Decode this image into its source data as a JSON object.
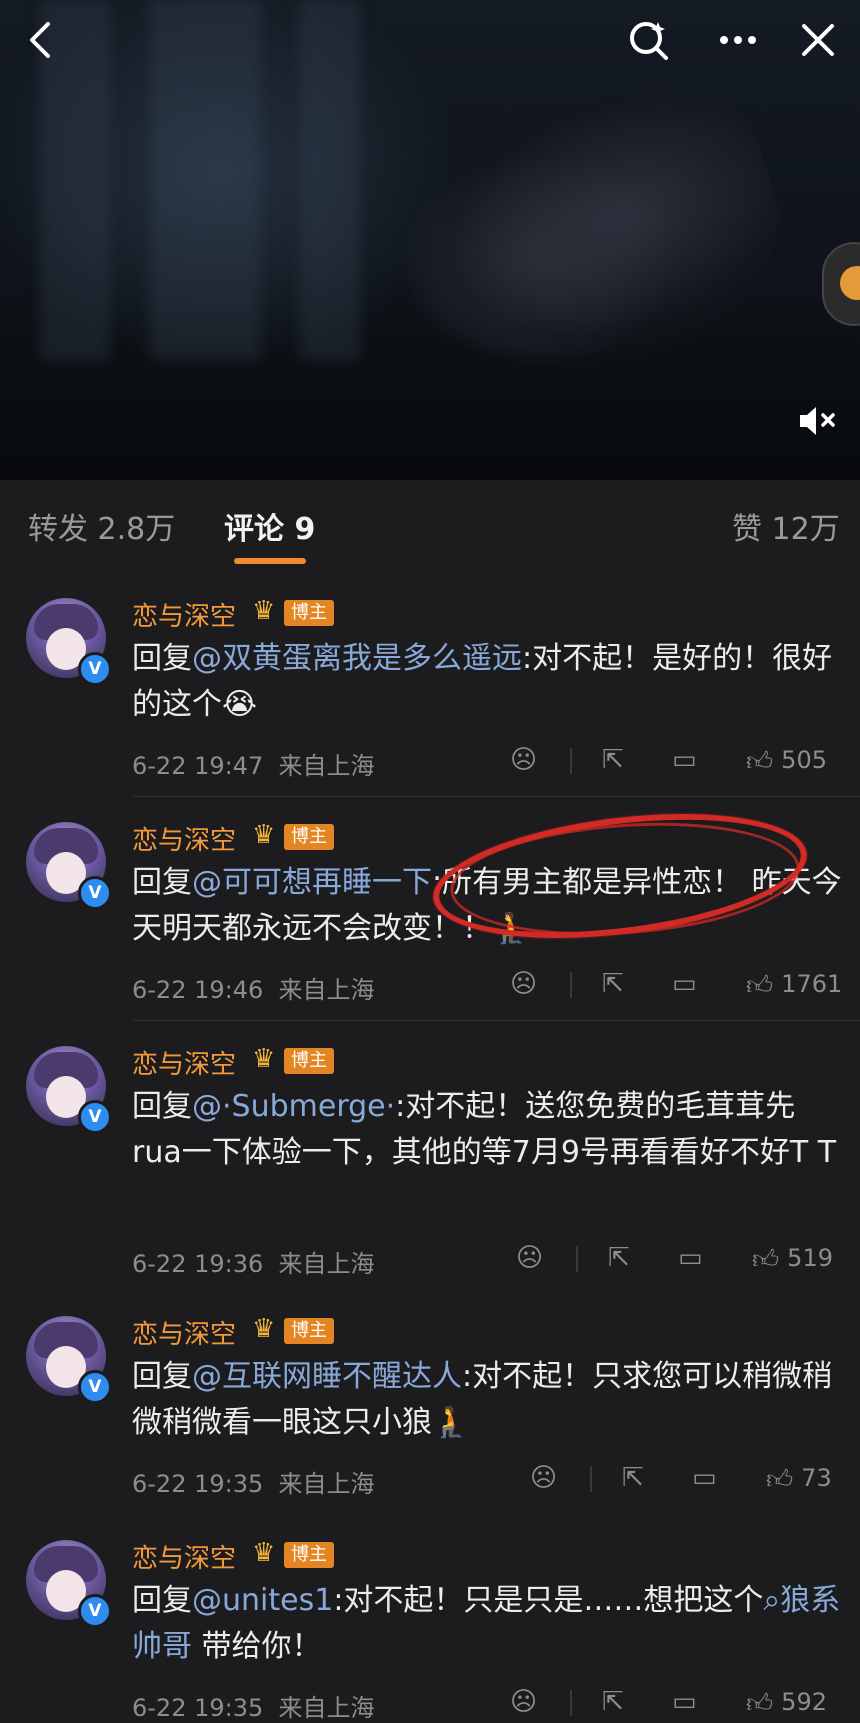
{
  "video": {
    "back_icon": "back-arrow-icon",
    "search_icon": "search-sparkle-icon",
    "more_icon": "more-dots-icon",
    "close_icon": "close-icon",
    "mute_icon": "muted-speaker-icon"
  },
  "tabs": {
    "repost": "转发 2.8万",
    "comments": "评论 9",
    "likes": "赞 12万",
    "accent": "#f08a2a"
  },
  "comments": [
    {
      "username": "恋与深空",
      "badge": "博主",
      "reply_prefix": "回复",
      "mention": "@双黄蛋离我是多么遥远",
      "body": ":对不起！是好的！很好的这个😭",
      "time": "6-22 19:47",
      "location": "来自上海",
      "likes": "505"
    },
    {
      "username": "恋与深空",
      "badge": "博主",
      "reply_prefix": "回复",
      "mention": "@可可想再睡一下",
      "body": ":所有男主都是异性恋！ 昨天今天明天都永远不会改变！！🧎",
      "time": "6-22 19:46",
      "location": "来自上海",
      "likes": "1761"
    },
    {
      "username": "恋与深空",
      "badge": "博主",
      "reply_prefix": "回复",
      "mention": "@·Submerge·",
      "body": ":对不起！送您免费的毛茸茸先rua一下体验一下，其他的等7月9号再看看好不好T T",
      "time": "6-22 19:36",
      "location": "来自上海",
      "likes": "519"
    },
    {
      "username": "恋与深空",
      "badge": "博主",
      "reply_prefix": "回复",
      "mention": "@互联网睡不醒达人",
      "body": ":对不起！只求您可以稍微稍微稍微看一眼这只小狼🧎",
      "time": "6-22 19:35",
      "location": "来自上海",
      "likes": "73"
    },
    {
      "username": "恋与深空",
      "badge": "博主",
      "reply_prefix": "回复",
      "mention": "@unites1",
      "body": ":对不起！只是只是……想把这个",
      "link": "狼系帅哥",
      "body_end": " 带给你！",
      "time": "6-22 19:35",
      "location": "来自上海",
      "likes": "592"
    }
  ]
}
